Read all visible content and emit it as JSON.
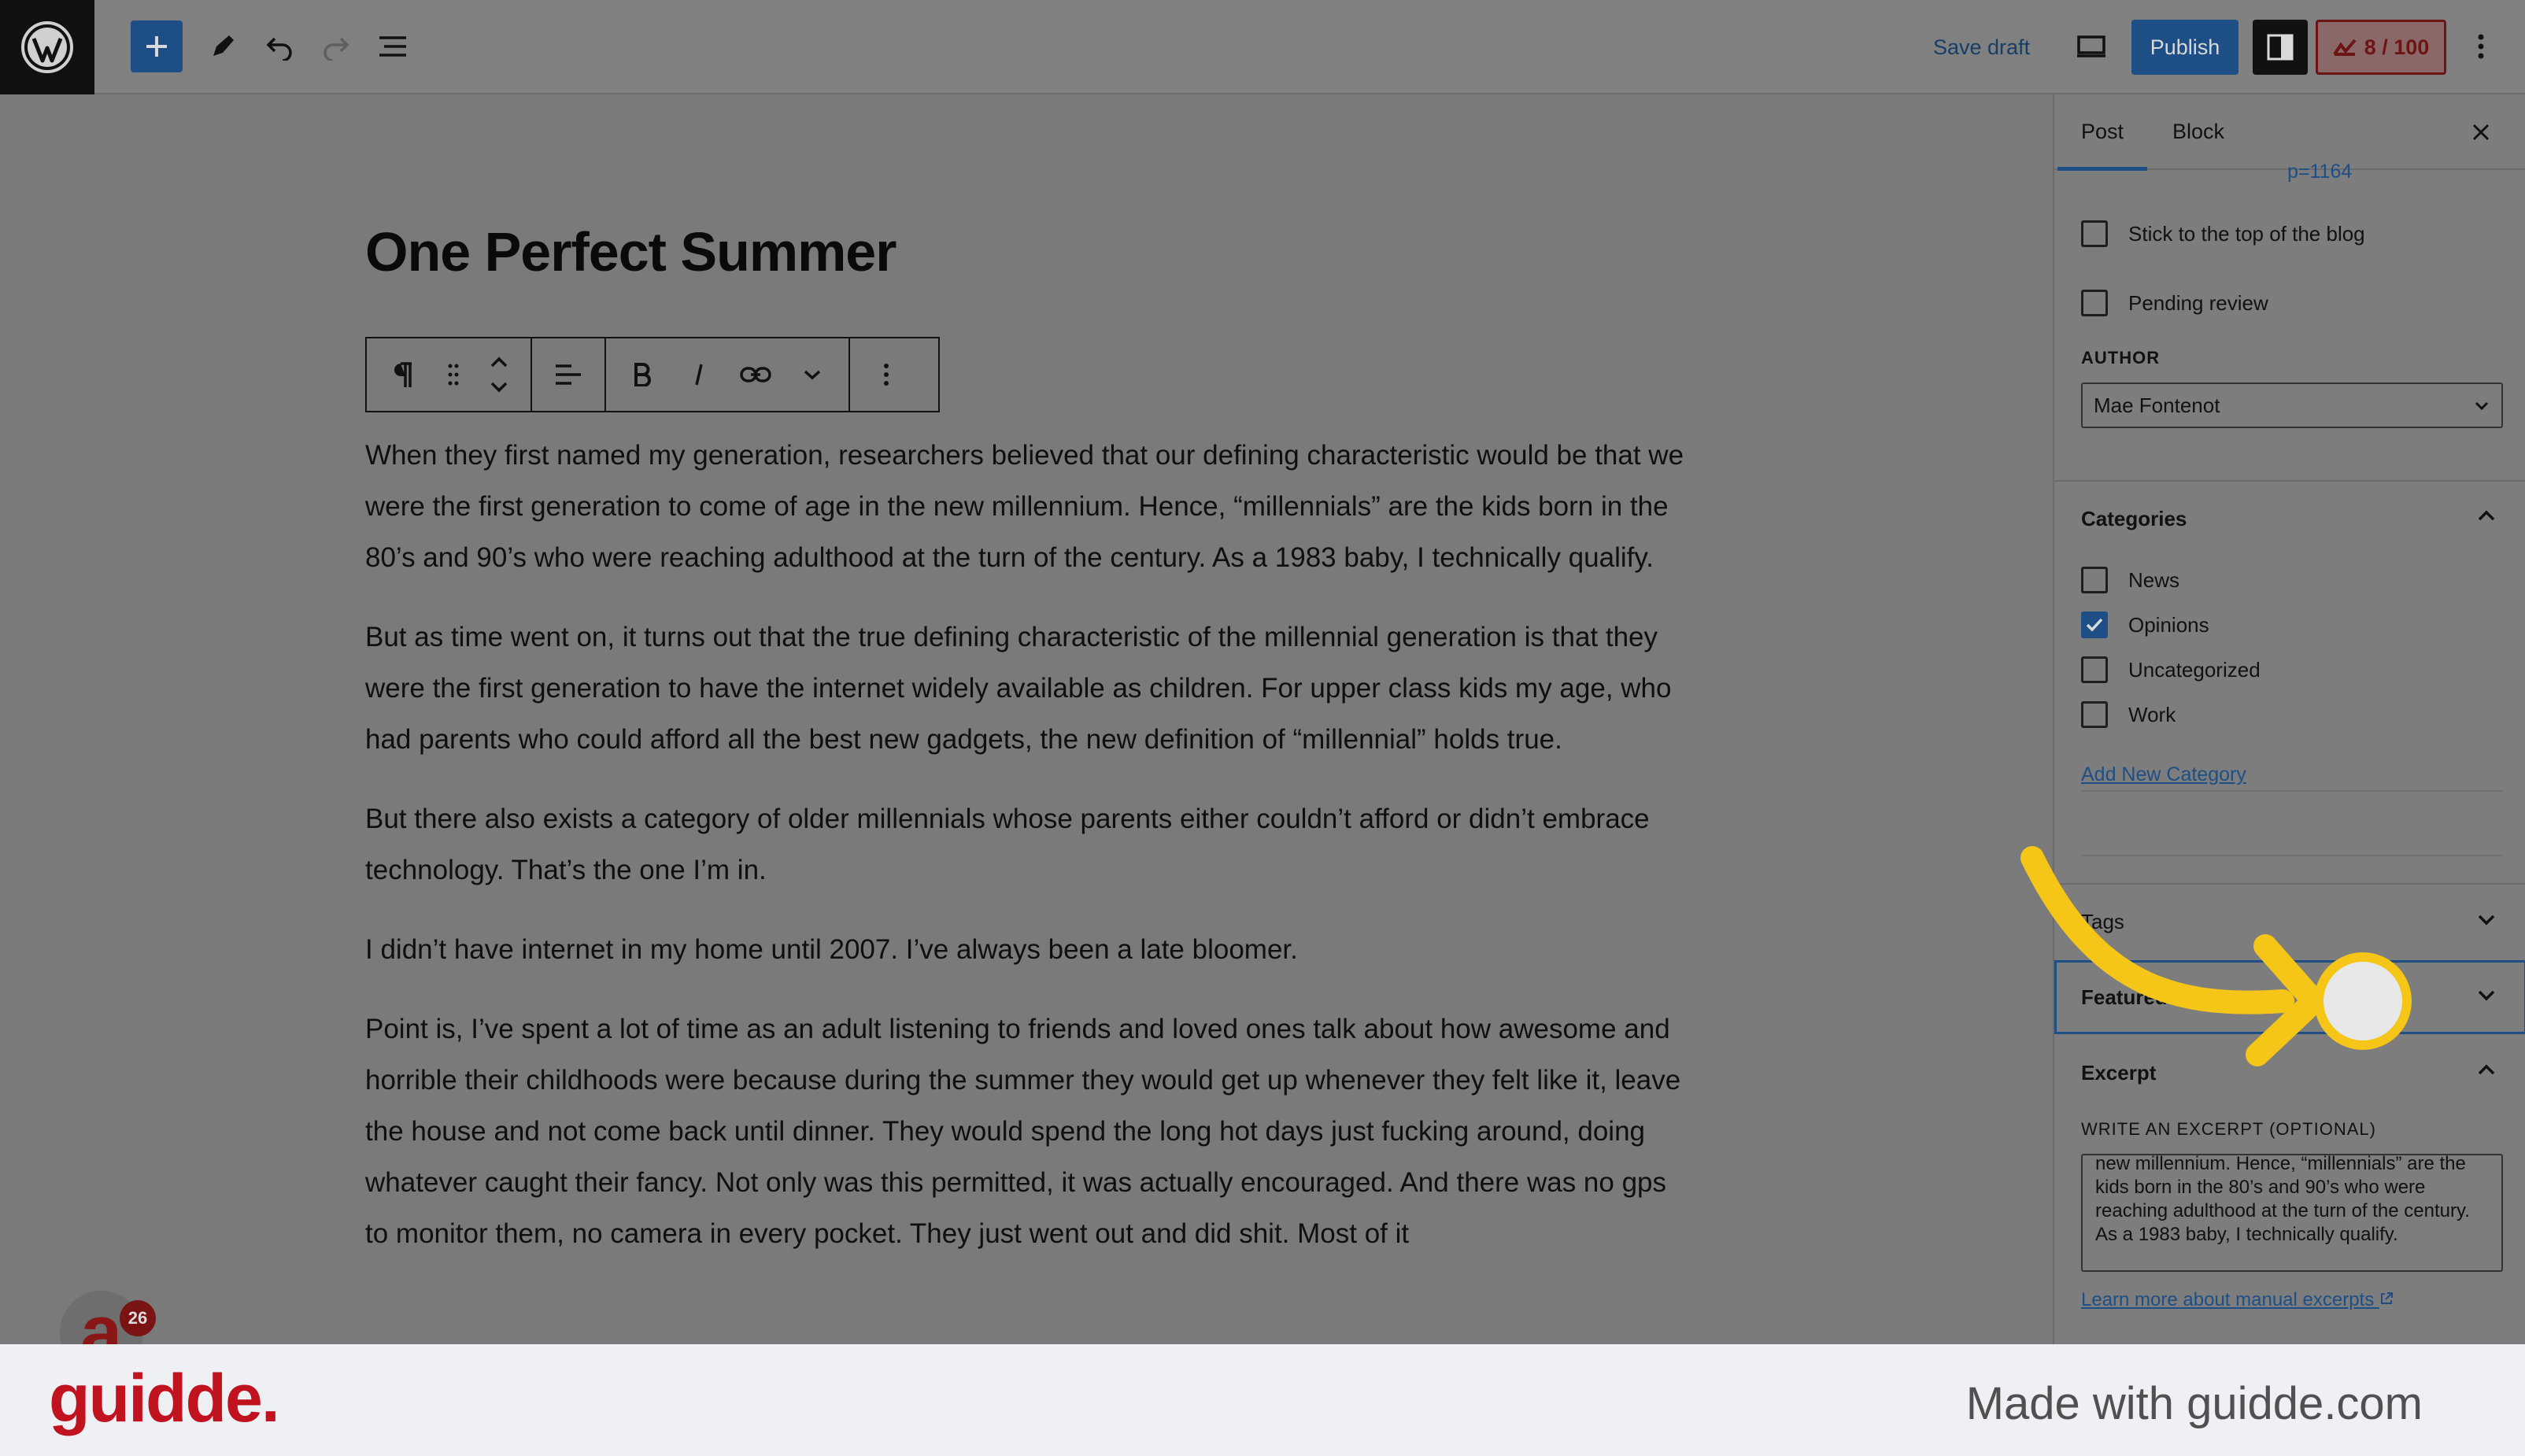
{
  "toolbar": {
    "save_draft": "Save draft",
    "publish": "Publish",
    "score": "8 / 100"
  },
  "post": {
    "title": "One Perfect Summer",
    "paragraphs": [
      "When they first named my generation, researchers believed that our defining characteristic would be that we were the first generation to come of age in the new millennium. Hence, “millennials” are the kids born in the 80’s and 90’s who were reaching adulthood at the turn of the century. As a 1983 baby, I technically qualify.",
      "But as time went on, it turns out that the true defining characteristic of the millennial generation is that they were the first generation to have the internet widely available as children. For upper class kids my age, who had parents who could afford all the best new gadgets, the new definition of “millennial” holds true.",
      "But there also exists a category of older millennials whose parents either couldn’t afford or didn’t embrace technology. That’s the one I’m in.",
      "I didn’t have internet in my home until 2007. I’ve always been a late bloomer.",
      "Point is, I’ve spent a lot of time as an adult listening to friends and loved ones talk about how awesome and horrible their childhoods were because during the summer they would get up whenever they felt like it, leave the house and not come back until dinner. They would spend the long hot days just fucking around, doing whatever caught their fancy. Not only was this permitted, it was actually encouraged. And there was no gps to monitor them, no camera in every pocket. They just went out and did shit. Most of it"
    ]
  },
  "sidebar": {
    "tabs": [
      "Post",
      "Block"
    ],
    "permalink_fragment": "p=1164",
    "stick_to_top": "Stick to the top of the blog",
    "pending_review": "Pending review",
    "author_label": "AUTHOR",
    "author_value": "Mae Fontenot",
    "categories_title": "Categories",
    "categories": [
      {
        "label": "News",
        "checked": false
      },
      {
        "label": "Opinions",
        "checked": true
      },
      {
        "label": "Uncategorized",
        "checked": false
      },
      {
        "label": "Work",
        "checked": false
      }
    ],
    "add_category": "Add New Category",
    "tags_title": "Tags",
    "featured_title": "Featured",
    "excerpt_title": "Excerpt",
    "excerpt_label": "WRITE AN EXCERPT (OPTIONAL)",
    "excerpt_text": "new millennium. Hence, “millennials” are the kids born in the 80’s and 90’s who were reaching adulthood at the turn of the century. As a 1983 baby, I technically qualify.",
    "excerpt_link": "Learn more about manual excerpts"
  },
  "notifications": {
    "badge_count": "26",
    "avatar_letter": "a"
  },
  "footer": {
    "brand": "guidde.",
    "made_with": "Made with guidde.com"
  },
  "colors": {
    "accent": "#1d4f86",
    "annotation": "#f5c518",
    "brand": "#c0121f"
  }
}
